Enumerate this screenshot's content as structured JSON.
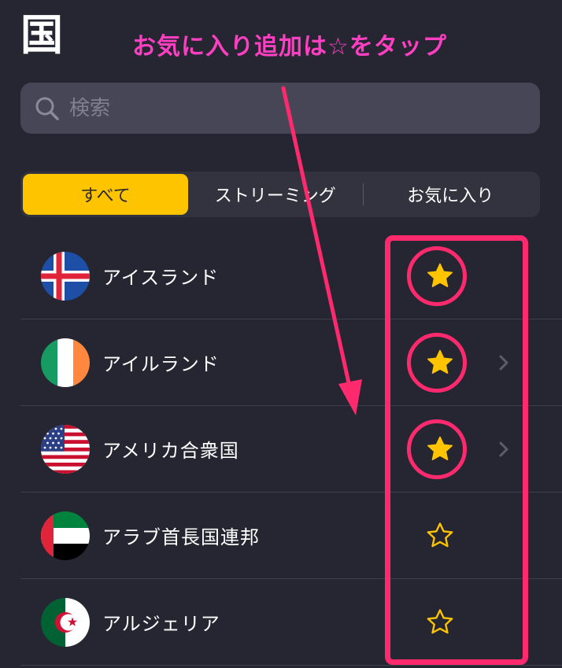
{
  "header": {
    "title": "国"
  },
  "annotation": {
    "text": "お気に入り追加は☆をタップ",
    "color": "#ff2a6e",
    "text_color": "#ff3fc2"
  },
  "search": {
    "placeholder": "検索",
    "value": ""
  },
  "tabs": [
    {
      "label": "すべて",
      "active": true
    },
    {
      "label": "ストリーミング",
      "active": false
    },
    {
      "label": "お気に入り",
      "active": false
    }
  ],
  "accent_color": "#ffc400",
  "countries": [
    {
      "name": "アイスランド",
      "flag": "iceland-flag-icon",
      "favorite": true,
      "chevron": false
    },
    {
      "name": "アイルランド",
      "flag": "ireland-flag-icon",
      "favorite": true,
      "chevron": true
    },
    {
      "name": "アメリカ合衆国",
      "flag": "usa-flag-icon",
      "favorite": true,
      "chevron": true
    },
    {
      "name": "アラブ首長国連邦",
      "flag": "uae-flag-icon",
      "favorite": false,
      "chevron": false
    },
    {
      "name": "アルジェリア",
      "flag": "algeria-flag-icon",
      "favorite": false,
      "chevron": false
    }
  ]
}
